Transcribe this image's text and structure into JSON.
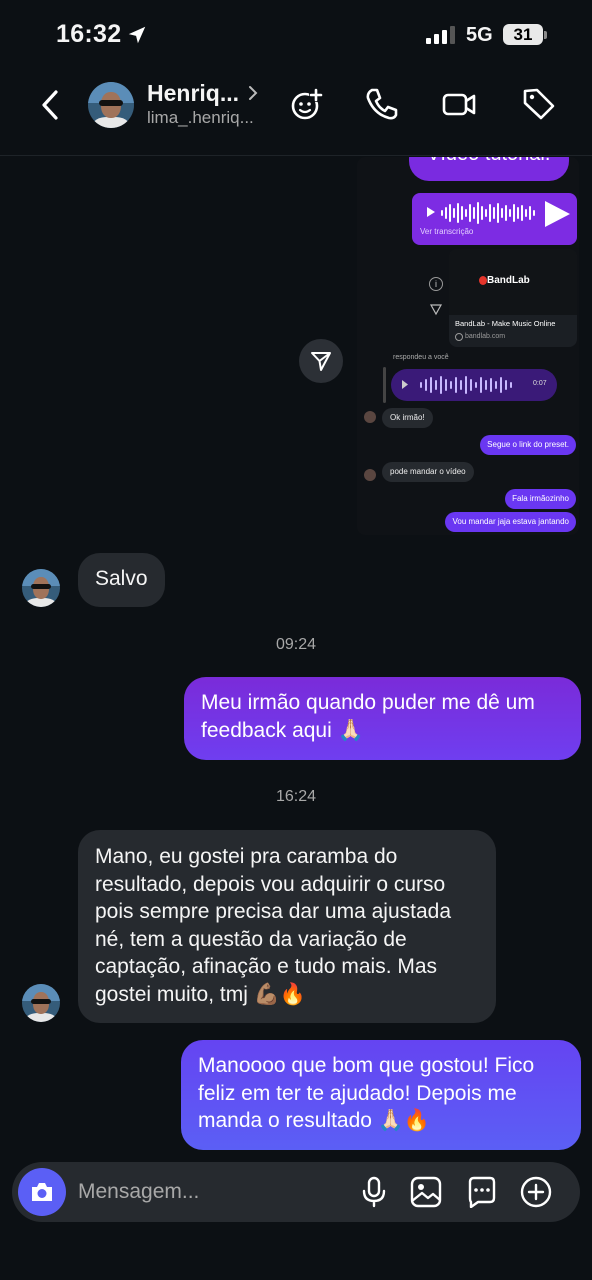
{
  "status_bar": {
    "time": "16:32",
    "network": "5G",
    "battery": "31"
  },
  "header": {
    "contact_name": "Henriq...",
    "contact_username": "lima_.henriq..."
  },
  "shared_image": {
    "top_bubble_text": "Vídeo tutorial.",
    "audio_transcript_label": "Ver transcrição",
    "link_card": {
      "brand": "BandLab",
      "title": "BandLab - Make Music Online",
      "url": "bandlab.com"
    },
    "replied_label": "respondeu a você",
    "audio_duration": "0:07",
    "messages": [
      {
        "side": "received",
        "text": "Ok irmão!"
      },
      {
        "side": "sent",
        "text": "Segue o link do preset."
      },
      {
        "side": "received",
        "text": "pode mandar o vídeo"
      },
      {
        "side": "sent",
        "text": "Fala irmãozinho"
      },
      {
        "side": "sent",
        "text": "Vou mandar jaja estava jantando"
      }
    ]
  },
  "chat": {
    "messages": [
      {
        "side": "received",
        "text": "Salvo"
      },
      {
        "type": "timestamp",
        "text": "09:24"
      },
      {
        "side": "sent",
        "text": "Meu irmão quando puder me dê um feedback aqui 🙏🏻"
      },
      {
        "type": "timestamp",
        "text": "16:24"
      },
      {
        "side": "received",
        "text": "Mano, eu gostei pra caramba do resultado, depois vou adquirir o curso pois sempre precisa dar uma ajustada né, tem a questão da variação de captação, afinação e tudo mais. Mas gostei muito, tmj 💪🏽🔥"
      },
      {
        "side": "sent",
        "text": "Manoooo que bom que gostou! Fico feliz em ter te ajudado! Depois me manda o resultado 🙏🏻🔥"
      }
    ]
  },
  "composer": {
    "placeholder": "Mensagem..."
  },
  "colors": {
    "background": "#0c1014",
    "sent_bubble_start": "#7a2bd9",
    "sent_bubble_end": "#5b5ff5",
    "received_bubble": "#262a2f",
    "accent": "#5b5ff5"
  },
  "icons": [
    "location-arrow-icon",
    "signal-icon",
    "back-chevron-icon",
    "add-effects-icon",
    "phone-icon",
    "video-camera-icon",
    "tag-icon",
    "share-arrow-icon",
    "camera-icon",
    "microphone-icon",
    "image-icon",
    "sticker-icon",
    "plus-circle-icon"
  ]
}
